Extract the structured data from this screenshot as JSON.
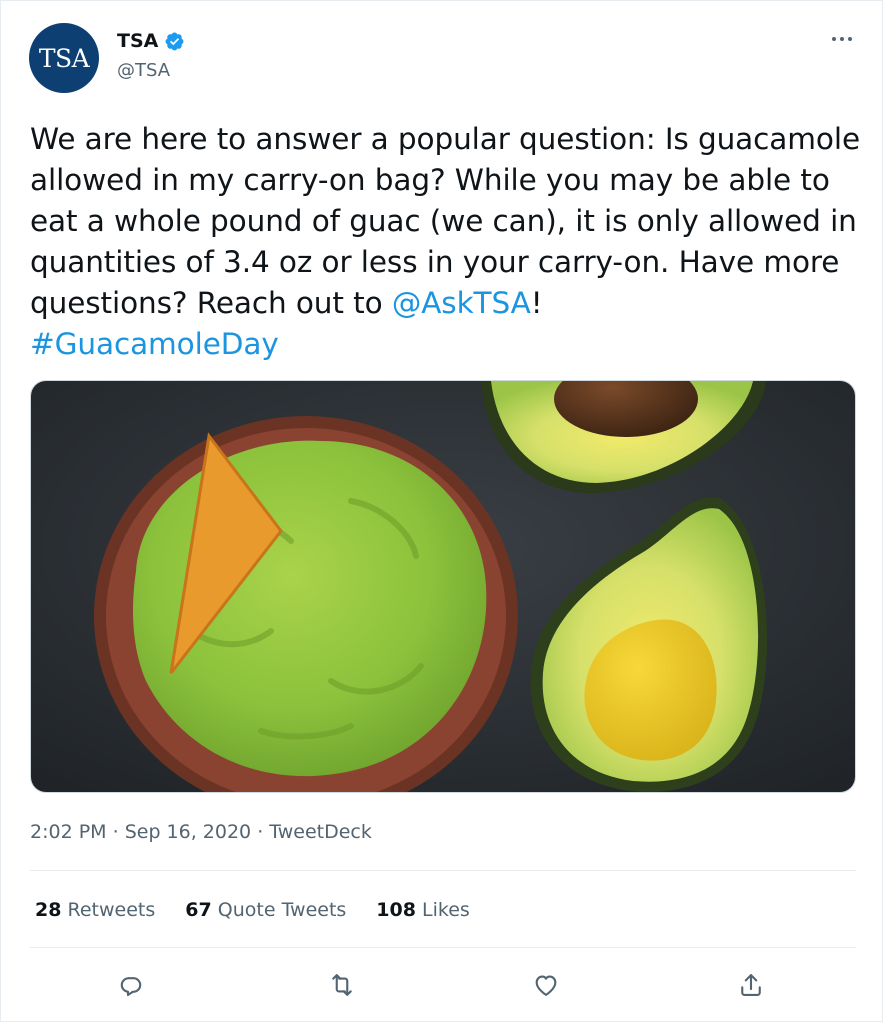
{
  "author": {
    "avatar_text": "TSA",
    "display_name": "TSA",
    "handle": "@TSA",
    "verified": true
  },
  "tweet": {
    "text_before_mention": "We are here to answer a popular question: Is guacamole allowed in my carry-on bag? While you may be able to eat a whole pound of guac (we can), it is only allowed in quantities of 3.4 oz or less in your carry-on. Have more questions? Reach out to ",
    "mention": "@AskTSA",
    "text_after_mention": "!",
    "hashtag": "#GuacamoleDay"
  },
  "meta": {
    "time": "2:02 PM",
    "separator1": " · ",
    "date": "Sep 16, 2020",
    "separator2": " · ",
    "source": "TweetDeck"
  },
  "stats": {
    "retweets_count": "28",
    "retweets_label": "Retweets",
    "quotes_count": "67",
    "quotes_label": "Quote Tweets",
    "likes_count": "108",
    "likes_label": "Likes"
  },
  "icons": {
    "more": "more-icon",
    "verified": "verified-badge-icon",
    "reply": "reply-icon",
    "retweet": "retweet-icon",
    "like": "like-icon",
    "share": "share-icon"
  },
  "colors": {
    "link": "#1b95e0",
    "verified": "#1d9bf0",
    "avatar_bg": "#0d3f73",
    "secondary_text": "#536471",
    "icon": "#536471"
  }
}
